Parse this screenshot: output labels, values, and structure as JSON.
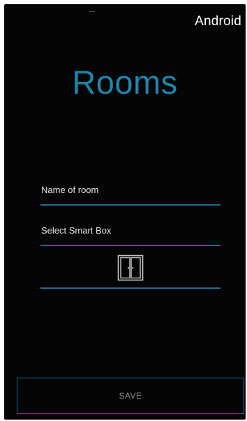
{
  "platform_label": "Android",
  "screen": {
    "title": "Rooms"
  },
  "form": {
    "name_label": "Name of room",
    "smartbox_label": "Select Smart Box",
    "room_icon": "door-icon"
  },
  "actions": {
    "save_label": "SAVE"
  },
  "colors": {
    "accent": "#1e86ad",
    "background": "#050505",
    "underline": "#1a6f93"
  }
}
